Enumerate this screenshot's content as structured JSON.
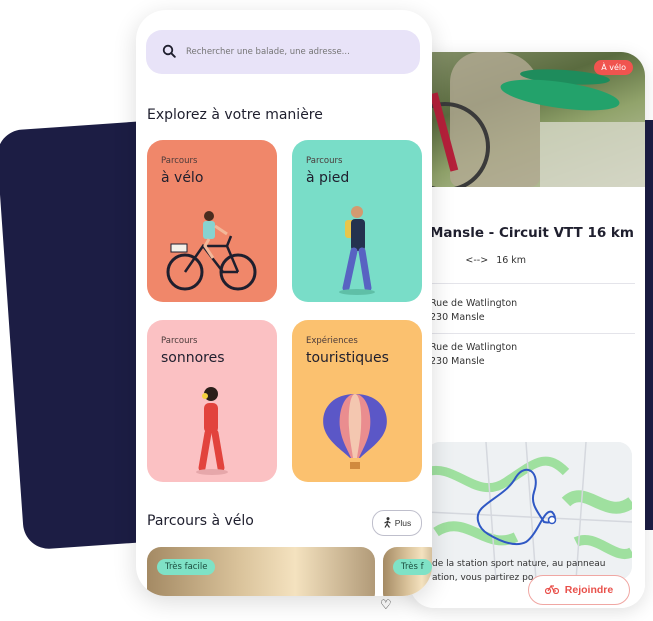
{
  "search": {
    "placeholder": "Rechercher une balade, une adresse..."
  },
  "explore": {
    "title": "Explorez à votre manière",
    "tiles": [
      {
        "sub": "Parcours",
        "main": "à vélo",
        "color": "#f0876a"
      },
      {
        "sub": "Parcours",
        "main": "à pied",
        "color": "#79ddc8"
      },
      {
        "sub": "Parcours",
        "main": "sonnores",
        "color": "#fbc1c3"
      },
      {
        "sub": "Expériences",
        "main": "touristiques",
        "color": "#fbc16f"
      }
    ]
  },
  "bike_section": {
    "title": "Parcours à vélo",
    "more_label": "Plus",
    "cards": [
      {
        "tag": "Très facile"
      },
      {
        "tag": "Très f"
      }
    ]
  },
  "detail": {
    "badge": "À vélo",
    "title": "Mansle - Circuit VTT 16 km",
    "duration_fragment": "ꜝ",
    "distance": "16 km",
    "address1_line1": "Rue de Watlington",
    "address1_line2": "230 Mansle",
    "address2_line1": "Rue de Watlington",
    "address2_line2": "230 Mansle",
    "description_line1": "de la station sport nature, au panneau",
    "description_line2": "ation, vous partirez po",
    "join_label": "Rejoindre"
  },
  "colors": {
    "navy": "#1c1d44",
    "accent_red": "#e9514b",
    "search_bg": "#e8e3f8"
  },
  "icons": [
    "search-icon",
    "walker-icon",
    "bike-icon",
    "heart-icon",
    "distance-arrows-icon"
  ]
}
